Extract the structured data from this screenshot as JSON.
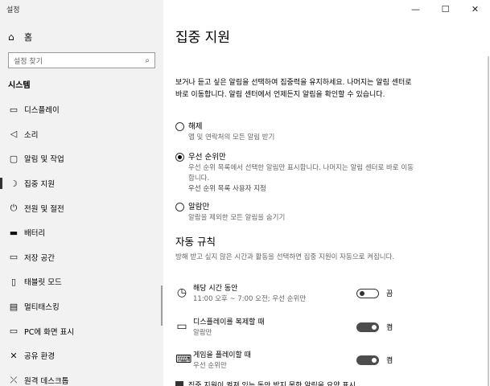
{
  "window": {
    "title": "설정",
    "controls": {
      "minimize": "—",
      "maximize": "☐",
      "close": "✕"
    }
  },
  "sidebar": {
    "home_label": "홈",
    "search_placeholder": "설정 찾기",
    "section": "시스템",
    "items": [
      {
        "label": "디스플레이",
        "icon": "monitor-icon"
      },
      {
        "label": "소리",
        "icon": "speaker-icon"
      },
      {
        "label": "알림 및 작업",
        "icon": "notification-icon"
      },
      {
        "label": "집중 지원",
        "icon": "moon-icon",
        "active": true
      },
      {
        "label": "전원 및 절전",
        "icon": "power-icon"
      },
      {
        "label": "배터리",
        "icon": "battery-icon"
      },
      {
        "label": "저장 공간",
        "icon": "storage-icon"
      },
      {
        "label": "태블릿 모드",
        "icon": "tablet-icon"
      },
      {
        "label": "멀티태스킹",
        "icon": "multitask-icon"
      },
      {
        "label": "PC에 화면 표시",
        "icon": "project-icon"
      },
      {
        "label": "공유 환경",
        "icon": "share-icon"
      },
      {
        "label": "원격 데스크톱",
        "icon": "remote-icon"
      }
    ]
  },
  "main": {
    "title": "집중 지원",
    "description": "보거나 듣고 싶은 알림을 선택하여 집중력을 유지하세요. 나머지는 알림 센터로 바로 이동합니다. 알림 센터에서 언제든지 알림을 확인할 수 있습니다.",
    "options": [
      {
        "label": "해제",
        "sub": "앱 및 연락처의 모든 알림 받기",
        "selected": false
      },
      {
        "label": "우선 순위만",
        "sub": "우선 순위 목록에서 선택한 알림만 표시합니다. 나머지는 알림 센터로 바로 이동합니다.",
        "link": "우선 순위 목록 사용자 지정",
        "selected": true
      },
      {
        "label": "알람만",
        "sub": "알람을 제외한 모든 알림을 숨기기",
        "selected": false
      }
    ],
    "rules_title": "자동 규칙",
    "rules_description": "방해 받고 싶지 않은 시간과 활동을 선택하면 집중 지원이 자동으로 켜집니다.",
    "rules": [
      {
        "name": "해당 시간 동안",
        "sub": "11:00 오후 ~ 7:00 오전; 우선 순위만",
        "state": "끔",
        "on": false,
        "icon": "clock-icon"
      },
      {
        "name": "디스플레이를 복제할 때",
        "sub": "알람만",
        "state": "켬",
        "on": true,
        "icon": "display-icon"
      },
      {
        "name": "게임을 플레이할 때",
        "sub": "우선 순위만",
        "state": "켬",
        "on": true,
        "icon": "gamepad-icon"
      }
    ],
    "bottom_checkbox": "집중 지원이 켜져 있는 동안 받지 못한 알림을 요약 표시"
  }
}
